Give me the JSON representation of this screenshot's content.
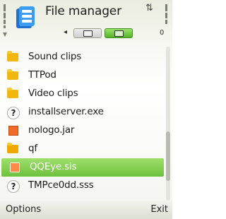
{
  "header": {
    "title": "File manager",
    "tab_left_arrow": "◂",
    "corner_icon": "⇅",
    "corner_value": "0"
  },
  "files": [
    {
      "name": "Sound clips",
      "icon": "folder-icon"
    },
    {
      "name": "TTPod",
      "icon": "folder-icon"
    },
    {
      "name": "Video clips",
      "icon": "folder-icon"
    },
    {
      "name": "installserver.exe",
      "icon": "unknown-file-icon"
    },
    {
      "name": "nologo.jar",
      "icon": "java-app-icon"
    },
    {
      "name": "qf",
      "icon": "folder-icon"
    },
    {
      "name": "QQEye.sis",
      "icon": "installer-package-icon",
      "selected": true
    },
    {
      "name": "TMPce0dd.sss",
      "icon": "unknown-file-icon"
    }
  ],
  "softkeys": {
    "left": "Options",
    "right": "Exit"
  },
  "colors": {
    "selection": "#7ccc48",
    "folder": "#f2b70f",
    "jar": "#f06a2a"
  }
}
